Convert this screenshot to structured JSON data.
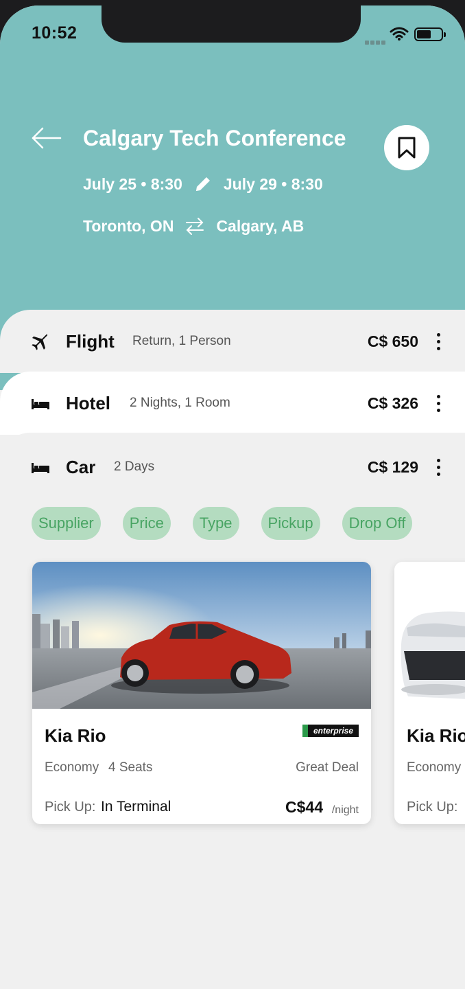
{
  "status_bar": {
    "time": "10:52"
  },
  "trip": {
    "title": "Calgary Tech Conference",
    "start_date": "July 25 • 8:30",
    "end_date": "July 29 • 8:30",
    "origin": "Toronto, ON",
    "destination": "Calgary, AB"
  },
  "bookings": [
    {
      "title": "Flight",
      "details": "Return, 1 Person",
      "price": "C$ 650",
      "icon": "airplane-icon"
    },
    {
      "title": "Hotel",
      "details": "2 Nights, 1 Room",
      "price": "C$ 326",
      "icon": "bed-icon"
    },
    {
      "title": "Car",
      "details": "2 Days",
      "price": "C$ 129",
      "icon": "bed-icon"
    }
  ],
  "filters": [
    "Supplier",
    "Price",
    "Type",
    "Pickup",
    "Drop Off"
  ],
  "cars": [
    {
      "name": "Kia Rio",
      "supplier": "enterprise",
      "class": "Economy",
      "seats": "4 Seats",
      "deal": "Great Deal",
      "pickup_label": "Pick Up:",
      "pickup_value": "In Terminal",
      "price": "C$44",
      "price_unit": "/night"
    },
    {
      "name": "Kia Rio",
      "class": "Economy",
      "pickup_label": "Pick Up:"
    }
  ],
  "colors": {
    "header": "#7bbfbe",
    "chip_bg": "#b4dcc0",
    "chip_text": "#48a463",
    "car_body": "#b8281c"
  }
}
